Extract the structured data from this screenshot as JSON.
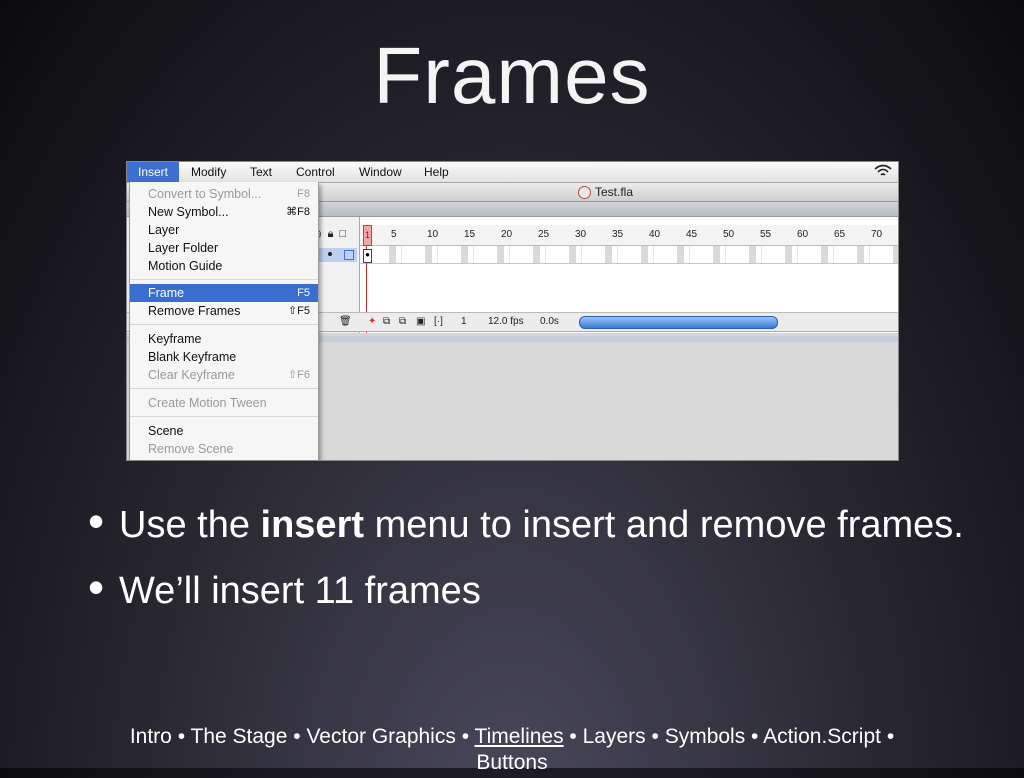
{
  "slide": {
    "title": "Frames",
    "bullets": [
      {
        "pre": "Use the ",
        "bold": "insert",
        "post": " menu to insert and remove frames."
      },
      {
        "pre": "We’ll insert 11 frames",
        "bold": "",
        "post": ""
      }
    ],
    "footer_items": [
      "Intro",
      "The Stage",
      "Vector Graphics",
      "Timelines",
      "Layers",
      "Symbols",
      "Action.Script"
    ],
    "footer_sep": " • ",
    "footer_last": "Buttons"
  },
  "screenshot": {
    "menubar": [
      "Insert",
      "Modify",
      "Text",
      "Control",
      "Window",
      "Help"
    ],
    "window_title": "Test.fla",
    "ruler_ticks": [
      "1",
      "5",
      "10",
      "15",
      "20",
      "25",
      "30",
      "35",
      "40",
      "45",
      "50",
      "55",
      "60",
      "65",
      "70"
    ],
    "status": {
      "frame": "1",
      "fps": "12.0 fps",
      "time": "0.0s"
    },
    "insert_menu": [
      {
        "label": "Convert to Symbol...",
        "shortcut": "F8",
        "disabled": true
      },
      {
        "label": "New Symbol...",
        "shortcut": "⌘F8",
        "disabled": false
      },
      {
        "label": "Layer",
        "shortcut": "",
        "disabled": false
      },
      {
        "label": "Layer Folder",
        "shortcut": "",
        "disabled": false
      },
      {
        "label": "Motion Guide",
        "shortcut": "",
        "disabled": false
      },
      {
        "label": "Frame",
        "shortcut": "F5",
        "disabled": false,
        "highlighted": true
      },
      {
        "label": "Remove Frames",
        "shortcut": "⇧F5",
        "disabled": false
      },
      {
        "label": "Keyframe",
        "shortcut": "",
        "disabled": false
      },
      {
        "label": "Blank Keyframe",
        "shortcut": "",
        "disabled": false
      },
      {
        "label": "Clear Keyframe",
        "shortcut": "⇧F6",
        "disabled": true
      },
      {
        "label": "Create Motion Tween",
        "shortcut": "",
        "disabled": true
      },
      {
        "label": "Scene",
        "shortcut": "",
        "disabled": false
      },
      {
        "label": "Remove Scene",
        "shortcut": "",
        "disabled": true
      }
    ],
    "colors": {
      "highlight": "#3a6dd0",
      "playhead": "#d03030"
    }
  }
}
